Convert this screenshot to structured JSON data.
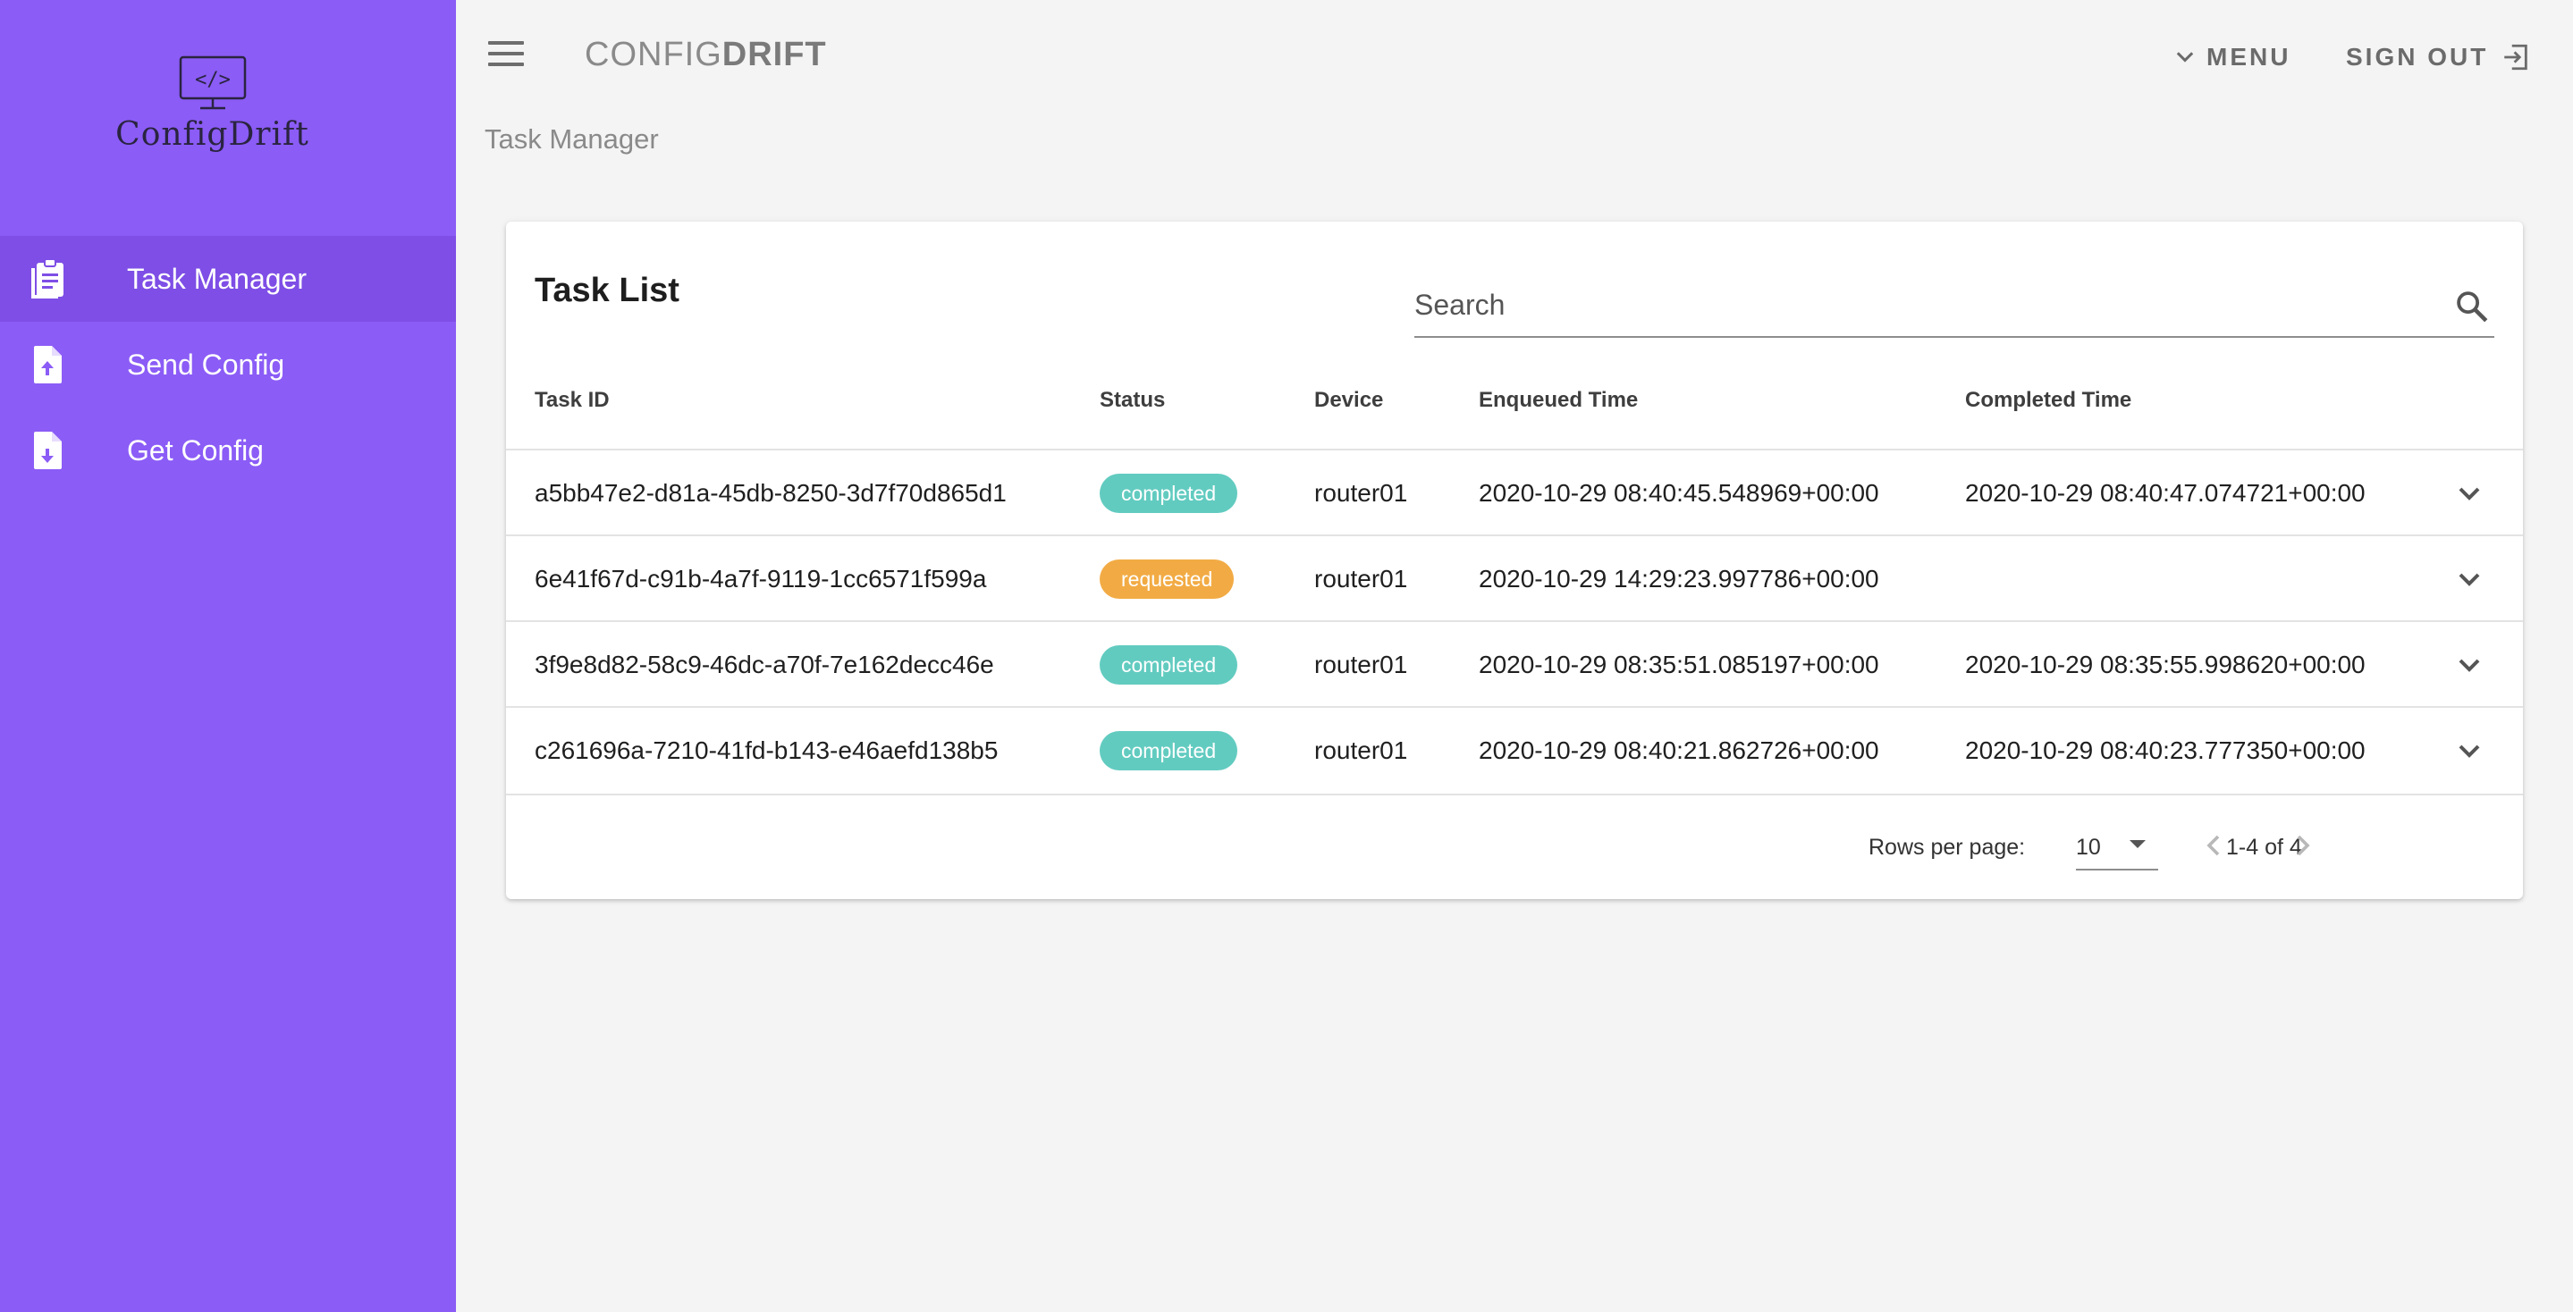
{
  "app": {
    "logo_text": "ConfigDrift",
    "brand_light": "CONFIG",
    "brand_bold": "DRIFT",
    "accent_color": "#8b5cf6"
  },
  "sidebar": {
    "items": [
      {
        "label": "Task Manager",
        "icon": "clipboard-icon",
        "active": true
      },
      {
        "label": "Send Config",
        "icon": "file-upload-icon",
        "active": false
      },
      {
        "label": "Get Config",
        "icon": "file-download-icon",
        "active": false
      }
    ]
  },
  "header": {
    "menu_label": "MENU",
    "signout_label": "SIGN OUT",
    "breadcrumb": "Task Manager"
  },
  "task_list": {
    "title": "Task List",
    "search_placeholder": "Search",
    "columns": [
      "Task ID",
      "Status",
      "Device",
      "Enqueued Time",
      "Completed Time"
    ],
    "rows": [
      {
        "task_id": "a5bb47e2-d81a-45db-8250-3d7f70d865d1",
        "status": "completed",
        "device": "router01",
        "enqueued": "2020-10-29 08:40:45.548969+00:00",
        "completed": "2020-10-29 08:40:47.074721+00:00"
      },
      {
        "task_id": "6e41f67d-c91b-4a7f-9119-1cc6571f599a",
        "status": "requested",
        "device": "router01",
        "enqueued": "2020-10-29 14:29:23.997786+00:00",
        "completed": ""
      },
      {
        "task_id": "3f9e8d82-58c9-46dc-a70f-7e162decc46e",
        "status": "completed",
        "device": "router01",
        "enqueued": "2020-10-29 08:35:51.085197+00:00",
        "completed": "2020-10-29 08:35:55.998620+00:00"
      },
      {
        "task_id": "c261696a-7210-41fd-b143-e46aefd138b5",
        "status": "completed",
        "device": "router01",
        "enqueued": "2020-10-29 08:40:21.862726+00:00",
        "completed": "2020-10-29 08:40:23.777350+00:00"
      }
    ],
    "status_colors": {
      "completed": "#62cbc0",
      "requested": "#f2ab44"
    },
    "pagination": {
      "rows_per_page_label": "Rows per page:",
      "rows_per_page": "10",
      "range": "1-4 of 4"
    }
  }
}
